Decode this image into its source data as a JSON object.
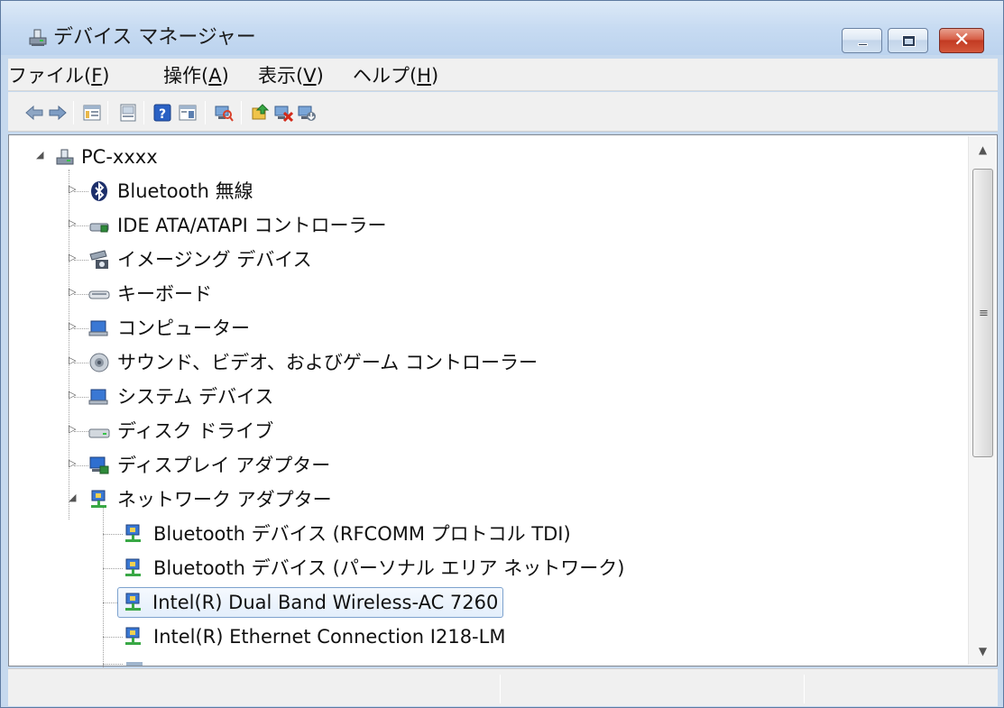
{
  "window": {
    "title": "デバイス マネージャー",
    "close_glyph": "✕"
  },
  "menu": [
    {
      "label": "ファイル(",
      "key": "F",
      "end": ")"
    },
    {
      "label": "操作(",
      "key": "A",
      "end": ")"
    },
    {
      "label": "表示(",
      "key": "V",
      "end": ")"
    },
    {
      "label": "ヘルプ(",
      "key": "H",
      "end": ")"
    }
  ],
  "toolbar": {
    "icons": [
      "back-arrow-icon",
      "forward-arrow-icon",
      "properties-grid-icon",
      "update-pane-icon",
      "help-icon",
      "action-pane-icon",
      "scan-hardware-icon",
      "update-driver-icon",
      "uninstall-icon",
      "disable-device-icon"
    ]
  },
  "tree": {
    "root": "PC-xxxx",
    "categories": [
      {
        "label": "Bluetooth 無線",
        "icon": "bluetooth-icon",
        "expanded": false
      },
      {
        "label": "IDE ATA/ATAPI コントローラー",
        "icon": "ide-controller-icon",
        "expanded": false
      },
      {
        "label": "イメージング デバイス",
        "icon": "camera-icon",
        "expanded": false
      },
      {
        "label": "キーボード",
        "icon": "keyboard-icon",
        "expanded": false
      },
      {
        "label": "コンピューター",
        "icon": "computer-icon",
        "expanded": false
      },
      {
        "label": "サウンド、ビデオ、およびゲーム コントローラー",
        "icon": "speaker-icon",
        "expanded": false
      },
      {
        "label": "システム デバイス",
        "icon": "system-device-icon",
        "expanded": false
      },
      {
        "label": "ディスク ドライブ",
        "icon": "disk-drive-icon",
        "expanded": false
      },
      {
        "label": "ディスプレイ アダプター",
        "icon": "display-adapter-icon",
        "expanded": false
      },
      {
        "label": "ネットワーク アダプター",
        "icon": "network-adapter-icon",
        "expanded": true
      }
    ],
    "network_children": [
      {
        "label": "Bluetooth デバイス (RFCOMM プロトコル TDI)"
      },
      {
        "label": "Bluetooth デバイス (パーソナル エリア ネットワーク)"
      },
      {
        "label": "Intel(R) Dual Band Wireless-AC 7260",
        "selected": true
      },
      {
        "label": "Intel(R) Ethernet Connection I218-LM"
      }
    ]
  },
  "scrollbar": {
    "up_glyph": "▲",
    "down_glyph": "▼",
    "grip_glyph": "≡"
  },
  "colors": {
    "titlebar": "#c7dbf2",
    "close_button": "#c23a22",
    "selection_border": "#7da2ce"
  }
}
